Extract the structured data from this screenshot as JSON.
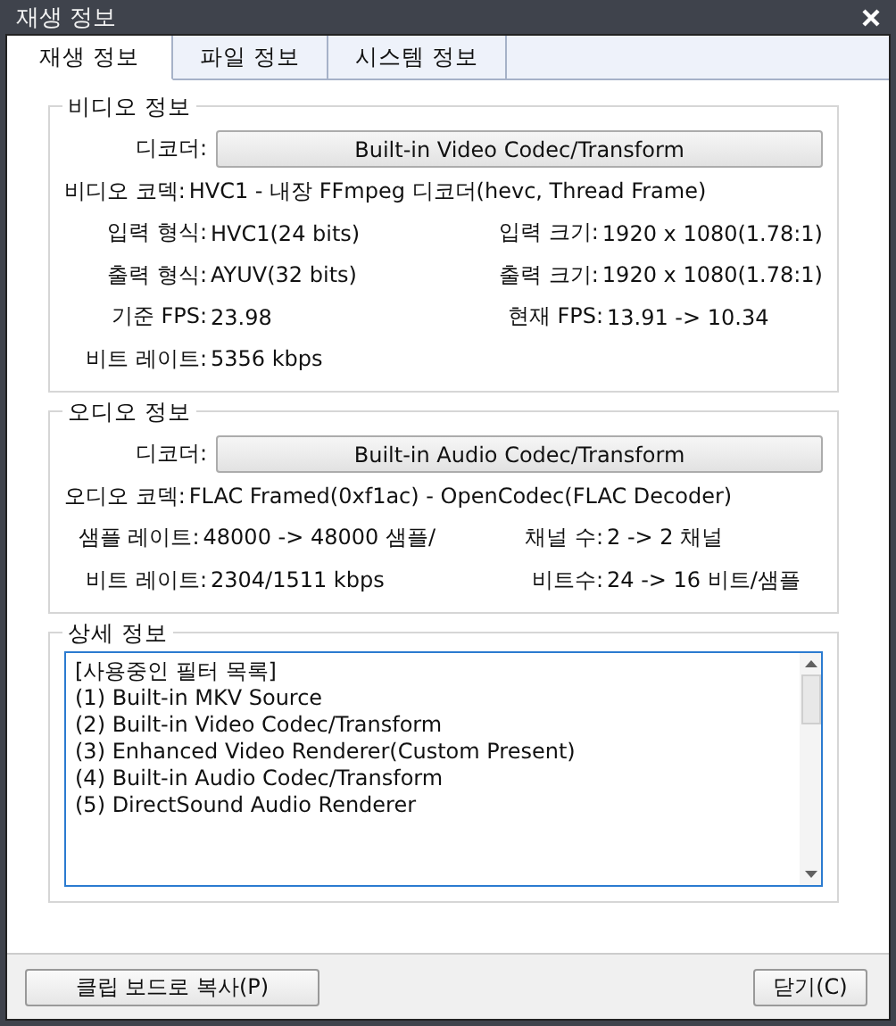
{
  "window": {
    "title": "재생 정보"
  },
  "tabs": [
    {
      "label": "재생 정보",
      "selected": true
    },
    {
      "label": "파일 정보",
      "selected": false
    },
    {
      "label": "시스템 정보",
      "selected": false
    }
  ],
  "video": {
    "title": "비디오 정보",
    "decoder_label": "디코더:",
    "decoder": "Built-in Video Codec/Transform",
    "rows": [
      [
        {
          "label": "비디오 코덱:",
          "value": "HVC1 - 내장 FFmpeg 디코더(hevc, Thread Frame)"
        }
      ],
      [
        {
          "label": "입력 형식:",
          "value": "HVC1(24 bits)"
        },
        {
          "label": "입력 크기:",
          "value": "1920 x 1080(1.78:1)"
        }
      ],
      [
        {
          "label": "출력 형식:",
          "value": "AYUV(32 bits)"
        },
        {
          "label": "출력 크기:",
          "value": "1920 x 1080(1.78:1)"
        }
      ],
      [
        {
          "label": "기준 FPS:",
          "value": "23.98"
        },
        {
          "label": "현재 FPS:",
          "value": "13.91 -> 10.34"
        }
      ],
      [
        {
          "label": "비트 레이트:",
          "value": "5356 kbps"
        }
      ]
    ]
  },
  "audio": {
    "title": "오디오 정보",
    "decoder_label": "디코더:",
    "decoder": "Built-in Audio Codec/Transform",
    "rows": [
      [
        {
          "label": "오디오 코덱:",
          "value": "FLAC Framed(0xf1ac) - OpenCodec(FLAC Decoder)"
        }
      ],
      [
        {
          "label": "샘플 레이트:",
          "value": "48000 -> 48000 샘플/"
        },
        {
          "label": "채널 수:",
          "value": "2 -> 2 채널"
        }
      ],
      [
        {
          "label": "비트 레이트:",
          "value": "2304/1511 kbps"
        },
        {
          "label": "비트수:",
          "value": "24 -> 16 비트/샘플"
        }
      ]
    ]
  },
  "details": {
    "title": "상세 정보",
    "lines": [
      "[사용중인 필터 목록]",
      "(1) Built-in MKV Source",
      "(2) Built-in Video Codec/Transform",
      "(3) Enhanced Video Renderer(Custom Present)",
      "(4) Built-in Audio Codec/Transform",
      "(5) DirectSound Audio Renderer"
    ]
  },
  "buttons": {
    "copy": "클립 보드로 복사(P)",
    "close": "닫기(C)"
  }
}
